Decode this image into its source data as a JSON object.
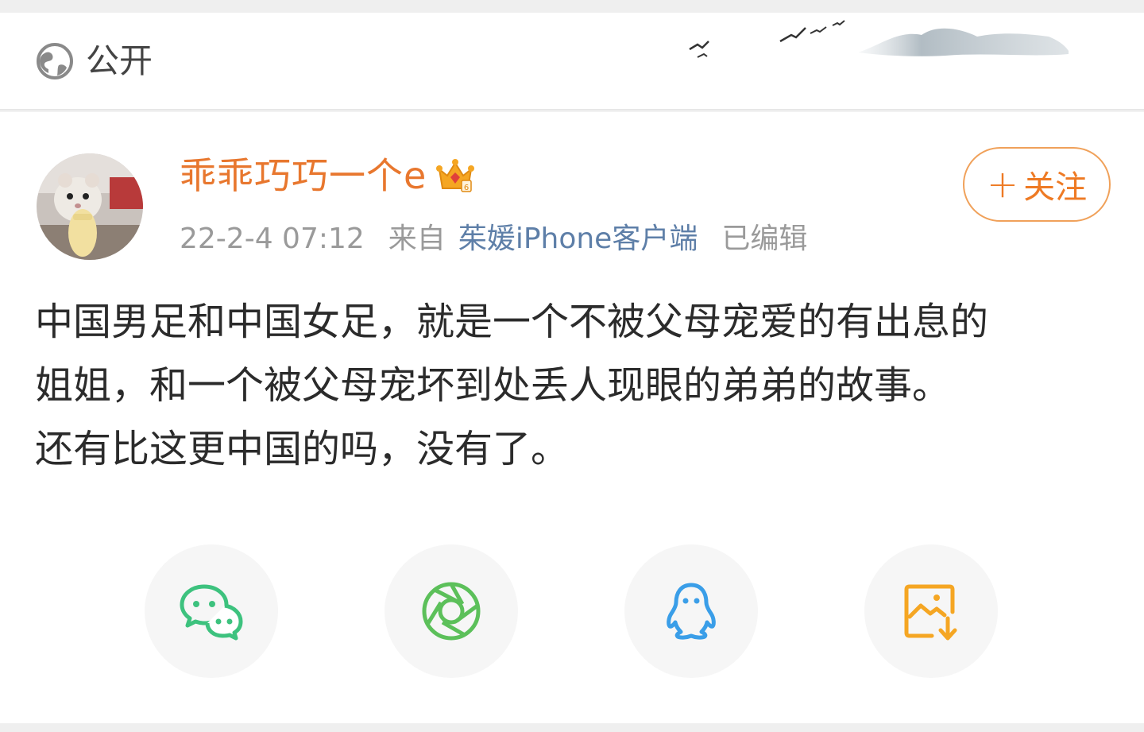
{
  "header": {
    "visibility_label": "公开",
    "visibility_icon": "globe-icon"
  },
  "post": {
    "author": {
      "name": "乖乖巧巧一个e",
      "badge_icon": "crown-vip-icon",
      "avatar": "hamster-avatar"
    },
    "meta": {
      "time": "22-2-4 07:12",
      "source_prefix": "来自",
      "source": "茱媛iPhone客户端",
      "edited": "已编辑"
    },
    "follow_button": {
      "plus": "+",
      "label": "关注"
    },
    "body_lines": [
      "中国男足和中国女足，就是一个不被父母宠爱的有出息的",
      "姐姐，和一个被父母宠坏到处丢人现眼的弟弟的故事。",
      "还有比这更中国的吗，没有了。"
    ]
  },
  "share": {
    "wechat": "wechat-icon",
    "moments": "moments-icon",
    "qq": "qq-icon",
    "save_image": "save-image-icon"
  },
  "colors": {
    "username": "#e8772e",
    "source": "#5e7fa8",
    "follow_border": "#f0a15a",
    "wechat": "#3dc27e",
    "moments": "#5cc05a",
    "qq": "#3a9ee8",
    "save": "#f5a623"
  }
}
